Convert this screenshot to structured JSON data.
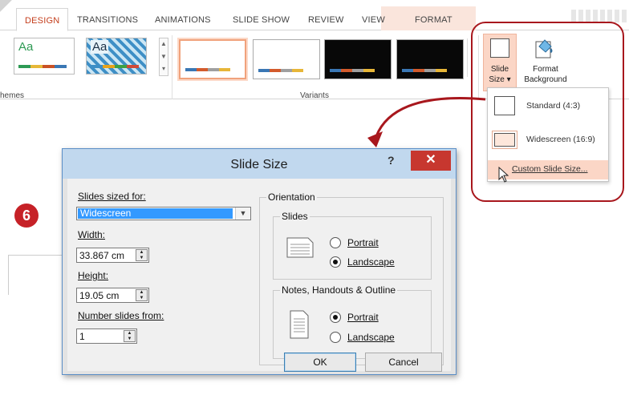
{
  "ribbon": {
    "tabs": [
      {
        "label": "DESIGN"
      },
      {
        "label": "TRANSITIONS"
      },
      {
        "label": "ANIMATIONS"
      },
      {
        "label": "SLIDE SHOW"
      },
      {
        "label": "REVIEW"
      },
      {
        "label": "VIEW"
      },
      {
        "label": "FORMAT"
      }
    ],
    "themes": [
      {
        "sample_text": "Aa"
      },
      {
        "sample_text": "Aa"
      }
    ],
    "themes_group_label": "hemes",
    "variants_group_label": "Variants",
    "slide_size_label": "Slide\nSize ▾",
    "format_background_label": "Format\nBackground"
  },
  "dropdown": {
    "items": [
      {
        "label": "Standard (4:3)"
      },
      {
        "label": "Widescreen (16:9)"
      },
      {
        "label": "Custom Slide Size..."
      }
    ]
  },
  "callout": {
    "step_number": "6",
    "ring_color": "#a8171d",
    "badge_color": "#c62127"
  },
  "dialog": {
    "title": "Slide Size",
    "help": "?",
    "close": "✕",
    "slides_sized_for_label": "Slides sized for:",
    "slides_sized_for_value": "Widescreen",
    "width_label": "Width:",
    "width_value": "33.867 cm",
    "height_label": "Height:",
    "height_value": "19.05 cm",
    "number_label": "Number slides from:",
    "number_value": "1",
    "orientation_label": "Orientation",
    "slides_group_label": "Slides",
    "slides_portrait": "Portrait",
    "slides_landscape": "Landscape",
    "slides_selected": "Landscape",
    "notes_group_label": "Notes, Handouts & Outline",
    "notes_portrait": "Portrait",
    "notes_landscape": "Landscape",
    "notes_selected": "Portrait",
    "ok_label": "OK",
    "cancel_label": "Cancel"
  },
  "colors": {
    "accent_tab": "#c43e1c",
    "format_tab_bg": "#fae5dc",
    "selected_highlight": "#fbd6c6",
    "dialog_title_bg": "#c1d8ee",
    "close_button": "#c7372f",
    "select_highlight": "#3399ff"
  }
}
